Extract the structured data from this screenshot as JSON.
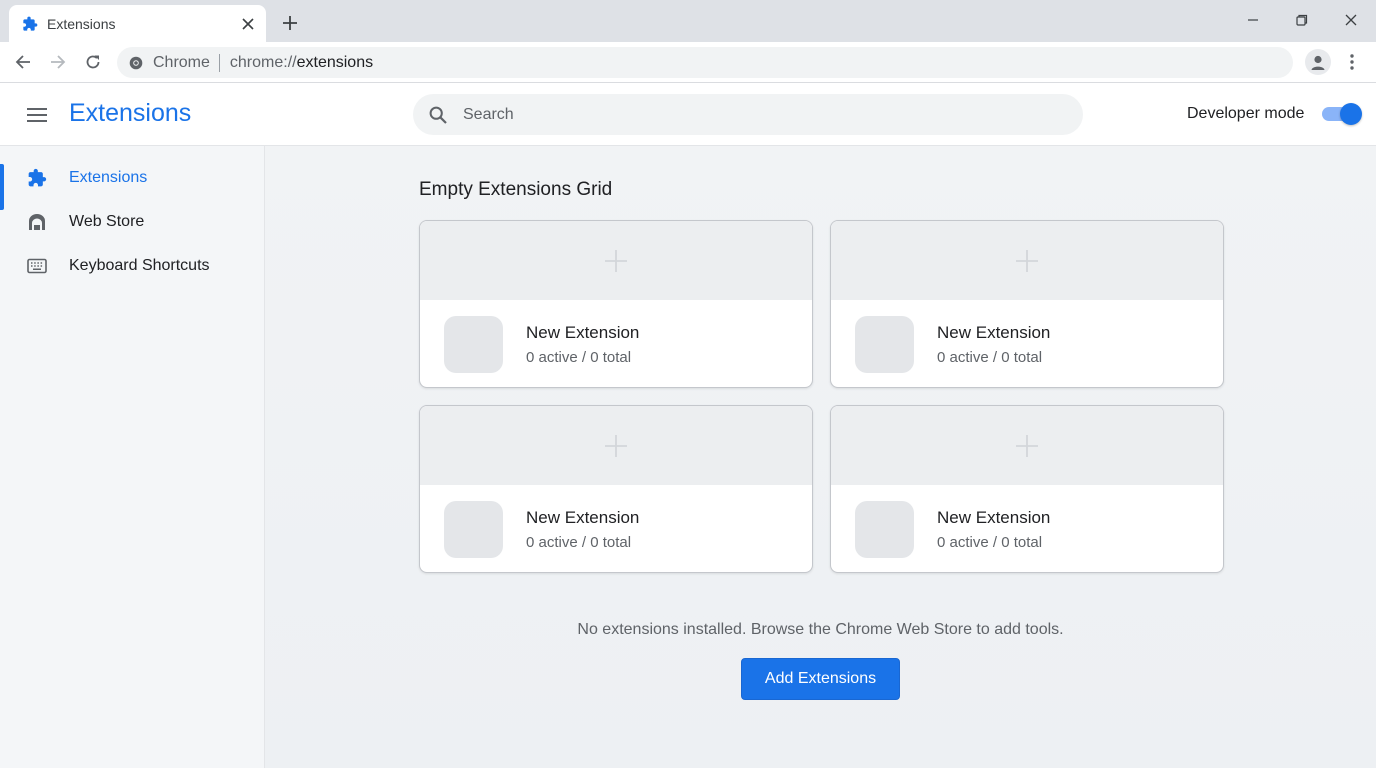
{
  "browser": {
    "tab": {
      "title": "Extensions",
      "icon": "puzzle-icon"
    },
    "omnibox": {
      "site_label": "Chrome",
      "url_scheme": "chrome://",
      "url_host": "extensions"
    }
  },
  "header": {
    "title": "Extensions",
    "search": {
      "placeholder": "Search",
      "value": ""
    },
    "developer_mode": {
      "label": "Developer mode",
      "enabled": true
    }
  },
  "sidebar": {
    "items": [
      {
        "label": "Extensions",
        "icon": "puzzle-icon",
        "active": true
      },
      {
        "label": "Web Store",
        "icon": "store-icon",
        "active": false
      },
      {
        "label": "Keyboard Shortcuts",
        "icon": "keyboard-icon",
        "active": false
      }
    ]
  },
  "main": {
    "grid_title": "Empty Extensions Grid",
    "cards": [
      {
        "name": "New Extension",
        "meta": "0 active / 0 total"
      },
      {
        "name": "New Extension",
        "meta": "0 active / 0 total"
      },
      {
        "name": "New Extension",
        "meta": "0 active / 0 total"
      },
      {
        "name": "New Extension",
        "meta": "0 active / 0 total"
      }
    ],
    "empty_message": "No extensions installed. Browse the Chrome Web Store to add tools.",
    "add_button_label": "Add Extensions"
  },
  "colors": {
    "accent": "#1a73e8",
    "toggle_track": "#8ab4f8",
    "tabstrip": "#dee1e6",
    "sidebar_bg": "#f4f6f8",
    "main_bg": "#f1f3f5"
  }
}
